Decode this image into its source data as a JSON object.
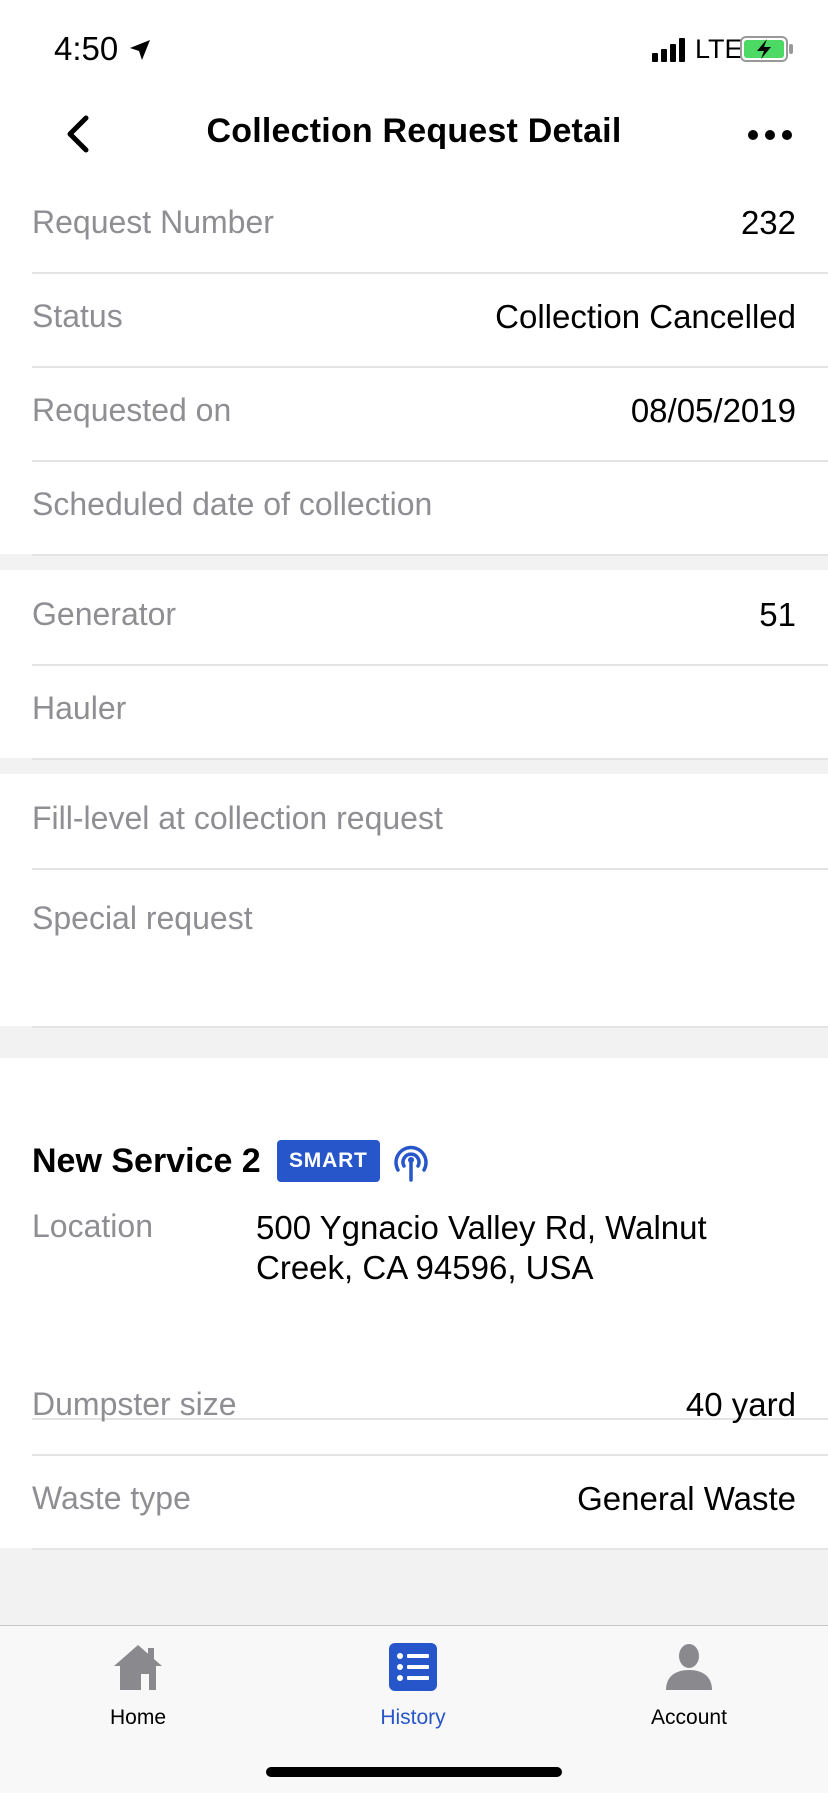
{
  "status_bar": {
    "time": "4:50",
    "network": "LTE"
  },
  "nav": {
    "title": "Collection Request Detail"
  },
  "request": [
    {
      "label": "Request Number",
      "value": "232"
    },
    {
      "label": "Status",
      "value": "Collection Cancelled"
    },
    {
      "label": "Requested on",
      "value": "08/05/2019"
    },
    {
      "label": "Scheduled date of collection",
      "value": ""
    }
  ],
  "parties": [
    {
      "label": "Generator",
      "value": "51"
    },
    {
      "label": "Hauler",
      "value": ""
    }
  ],
  "fill": [
    {
      "label": "Fill-level at collection request",
      "value": ""
    },
    {
      "label": "Special request",
      "value": ""
    }
  ],
  "service": {
    "title": "New Service 2",
    "badge": "SMART",
    "location_label": "Location",
    "location_value": "500 Ygnacio Valley Rd, Walnut Creek, CA 94596, USA",
    "rows": [
      {
        "label": "Dumpster size",
        "value": "40 yard"
      },
      {
        "label": "Waste type",
        "value": "General Waste"
      }
    ]
  },
  "tabs": [
    {
      "label": "Home",
      "icon": "home-icon",
      "active": false
    },
    {
      "label": "History",
      "icon": "list-icon",
      "active": true
    },
    {
      "label": "Account",
      "icon": "person-icon",
      "active": false
    }
  ],
  "colors": {
    "accent": "#2656c9",
    "label_gray": "#8e8e93",
    "battery_green": "#4cd964"
  }
}
